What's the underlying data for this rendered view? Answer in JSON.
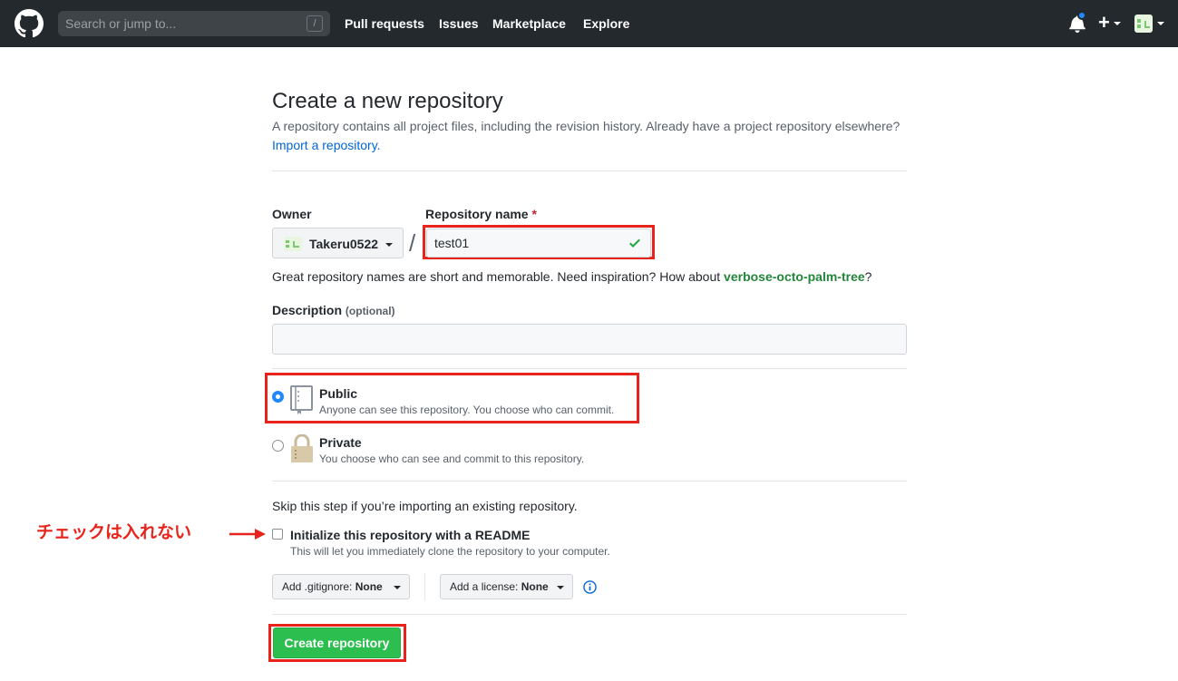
{
  "nav": {
    "search_placeholder": "Search or jump to...",
    "slash_key": "/",
    "links": [
      "Pull requests",
      "Issues",
      "Marketplace",
      "Explore"
    ]
  },
  "page": {
    "title": "Create a new repository",
    "subtitle": "A repository contains all project files, including the revision history. Already have a project repository elsewhere?",
    "import_link": "Import a repository."
  },
  "form": {
    "owner_label": "Owner",
    "owner_value": "Takeru0522",
    "slash": "/",
    "repo_label": "Repository name",
    "required_mark": "*",
    "repo_value": "test01",
    "hint_text": "Great repository names are short and memorable. Need inspiration? How about",
    "hint_suggestion": "verbose-octo-palm-tree",
    "hint_end": "?",
    "description_label": "Description",
    "description_optional": "(optional)",
    "description_value": "",
    "public_title": "Public",
    "public_desc": "Anyone can see this repository. You choose who can commit.",
    "private_title": "Private",
    "private_desc": "You choose who can see and commit to this repository.",
    "skip_text": "Skip this step if you’re importing an existing repository.",
    "readme_title": "Initialize this repository with a README",
    "readme_desc": "This will let you immediately clone the repository to your computer.",
    "gitignore_prefix": "Add .gitignore:",
    "gitignore_value": "None",
    "license_prefix": "Add a license:",
    "license_value": "None",
    "create_button": "Create repository"
  },
  "annotation": {
    "note": "チェックは入れない",
    "color": "#e8231b"
  },
  "state": {
    "visibility": "public",
    "readme_checked": false
  },
  "colors": {
    "header_bg": "#24292e",
    "link": "#0366d6",
    "success": "#2cbe4e",
    "suggestion": "#22863a"
  }
}
